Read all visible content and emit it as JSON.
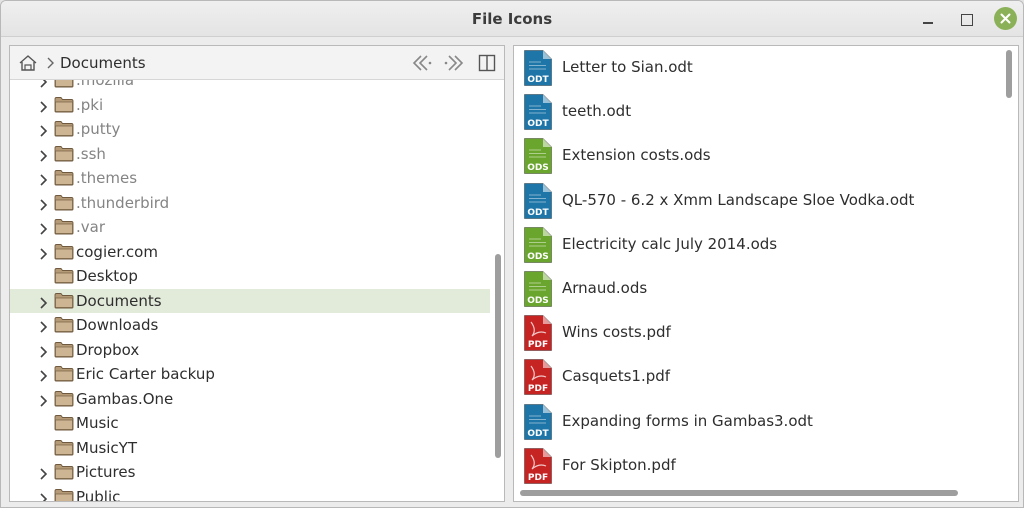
{
  "window": {
    "title": "File Icons"
  },
  "toolbar": {
    "breadcrumb": "Documents"
  },
  "tree": {
    "items": [
      {
        "label": ".mozilla",
        "hidden": true,
        "expandable": true
      },
      {
        "label": ".pki",
        "hidden": true,
        "expandable": true
      },
      {
        "label": ".putty",
        "hidden": true,
        "expandable": true
      },
      {
        "label": ".ssh",
        "hidden": true,
        "expandable": true
      },
      {
        "label": ".themes",
        "hidden": true,
        "expandable": true
      },
      {
        "label": ".thunderbird",
        "hidden": true,
        "expandable": true
      },
      {
        "label": ".var",
        "hidden": true,
        "expandable": true
      },
      {
        "label": "cogier.com",
        "hidden": false,
        "expandable": true
      },
      {
        "label": "Desktop",
        "hidden": false,
        "expandable": false
      },
      {
        "label": "Documents",
        "hidden": false,
        "expandable": true,
        "selected": true
      },
      {
        "label": "Downloads",
        "hidden": false,
        "expandable": true
      },
      {
        "label": "Dropbox",
        "hidden": false,
        "expandable": true
      },
      {
        "label": "Eric Carter backup",
        "hidden": false,
        "expandable": true
      },
      {
        "label": "Gambas.One",
        "hidden": false,
        "expandable": true
      },
      {
        "label": "Music",
        "hidden": false,
        "expandable": false
      },
      {
        "label": "MusicYT",
        "hidden": false,
        "expandable": false
      },
      {
        "label": "Pictures",
        "hidden": false,
        "expandable": true
      },
      {
        "label": "Public",
        "hidden": false,
        "expandable": true
      }
    ]
  },
  "files": {
    "items": [
      {
        "name": "Letter to Sian.odt",
        "type": "ODT"
      },
      {
        "name": "teeth.odt",
        "type": "ODT"
      },
      {
        "name": "Extension costs.ods",
        "type": "ODS"
      },
      {
        "name": "QL-570 - 6.2 x Xmm Landscape Sloe Vodka.odt",
        "type": "ODT"
      },
      {
        "name": "Electricity calc July 2014.ods",
        "type": "ODS"
      },
      {
        "name": "Arnaud.ods",
        "type": "ODS"
      },
      {
        "name": "Wins costs.pdf",
        "type": "PDF"
      },
      {
        "name": "Casquets1.pdf",
        "type": "PDF"
      },
      {
        "name": "Expanding forms in Gambas3.odt",
        "type": "ODT"
      },
      {
        "name": "For Skipton.pdf",
        "type": "PDF"
      }
    ]
  },
  "colors": {
    "ODT": "#1e75a8",
    "ODS": "#6aa62e",
    "PDF": "#c62323",
    "accent": "#8bb158",
    "selection": "#e2ead9"
  },
  "icons": {
    "home": "home-icon",
    "back": "back-icon",
    "forward": "forward-icon",
    "panel": "split-panel-icon",
    "folder": "folder-icon",
    "expand": "chevron-right-icon"
  }
}
